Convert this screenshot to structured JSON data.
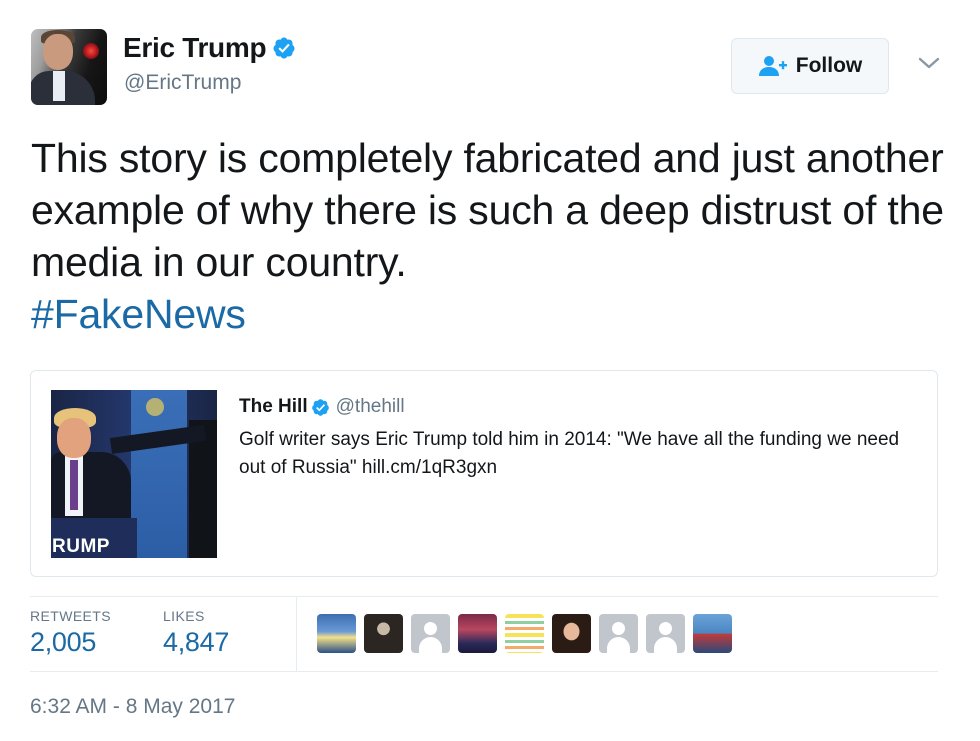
{
  "author": {
    "display_name": "Eric Trump",
    "handle": "@EricTrump",
    "verified": true
  },
  "follow_button": {
    "label": "Follow",
    "icon": "add-user-icon"
  },
  "more_menu": {
    "icon": "chevron-down-icon"
  },
  "tweet": {
    "text": "This story is completely fabricated and just another example of why there is such a deep distrust of the media in our country.",
    "hashtag": "#FakeNews"
  },
  "quoted_tweet": {
    "display_name": "The Hill",
    "handle": "@thehill",
    "verified": true,
    "text": "Golf writer says Eric Trump told him in 2014: \"We have all the funding we need out of Russia\" hill.cm/1qR3gxn",
    "image_caption_text": "RUMP"
  },
  "stats": {
    "retweets_label": "RETWEETS",
    "retweets_value": "2,005",
    "likes_label": "LIKES",
    "likes_value": "4,847"
  },
  "likers": [
    {
      "type": "photo",
      "icon": "sky-sunrise-avatar"
    },
    {
      "type": "photo",
      "icon": "person-dark-avatar"
    },
    {
      "type": "default",
      "icon": "default-user-avatar"
    },
    {
      "type": "photo",
      "icon": "trump-campaign-avatar"
    },
    {
      "type": "photo",
      "icon": "striped-pattern-avatar"
    },
    {
      "type": "photo",
      "icon": "woman-portrait-avatar"
    },
    {
      "type": "default",
      "icon": "default-user-avatar"
    },
    {
      "type": "default",
      "icon": "default-user-avatar"
    },
    {
      "type": "photo",
      "icon": "person-red-avatar"
    }
  ],
  "timestamp": "6:32 AM - 8 May 2017",
  "colors": {
    "link": "#1b6aa5",
    "verified": "#1da1f2",
    "muted": "#657786",
    "border": "#e1e8ed"
  }
}
